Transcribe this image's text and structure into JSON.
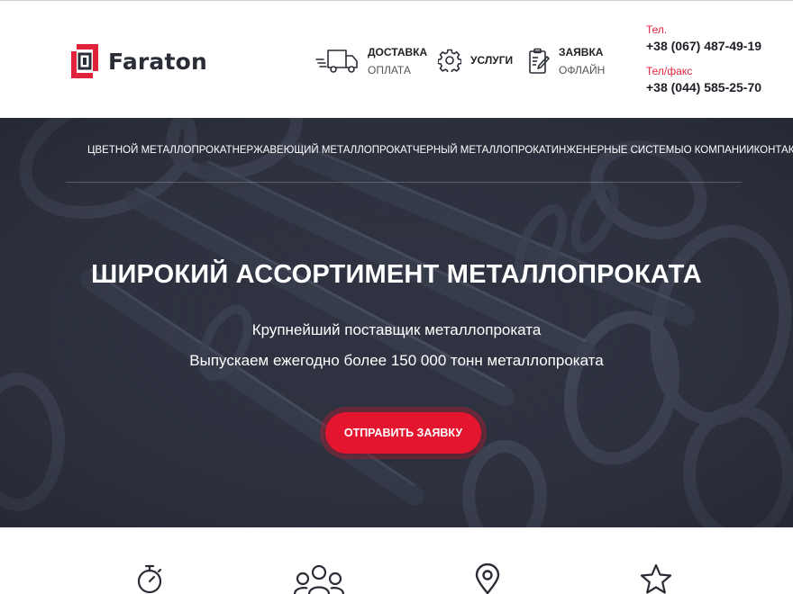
{
  "brand": {
    "name": "Faraton",
    "accent": "#e0233b",
    "dark": "#2f3341"
  },
  "header": {
    "delivery": {
      "line1": "Доставка",
      "line2": "Оплата",
      "icon": "truck-icon"
    },
    "services": {
      "label": "Услуги",
      "icon": "gear-icon"
    },
    "request": {
      "line1": "Заявка",
      "line2": "Офлайн",
      "icon": "clipboard-edit-icon"
    },
    "contacts": {
      "phone_label": "Тел.",
      "phone": "+38 (067) 487-49-19",
      "fax_label": "Тел/факс",
      "fax": "+38 (044) 585-25-70"
    }
  },
  "nav": {
    "items": [
      {
        "label": "Цветной металлопрокат"
      },
      {
        "label": "Нержавеющий металлопрокат"
      },
      {
        "label": "Черный металлопрокат"
      },
      {
        "label": "Инженерные системы"
      },
      {
        "label": "О компании"
      },
      {
        "label": "Контакты"
      }
    ]
  },
  "hero": {
    "title": "Широкий ассортимент металлопроката",
    "subtitle_1": "Крупнейший поставщик металлопроката",
    "subtitle_2": "Выпускаем ежегодно более 150 000 тонн металлопроката",
    "cta": "Отправить заявку"
  },
  "features": {
    "icons": [
      "stopwatch-icon",
      "team-icon",
      "location-pin-icon",
      "star-icon"
    ]
  }
}
